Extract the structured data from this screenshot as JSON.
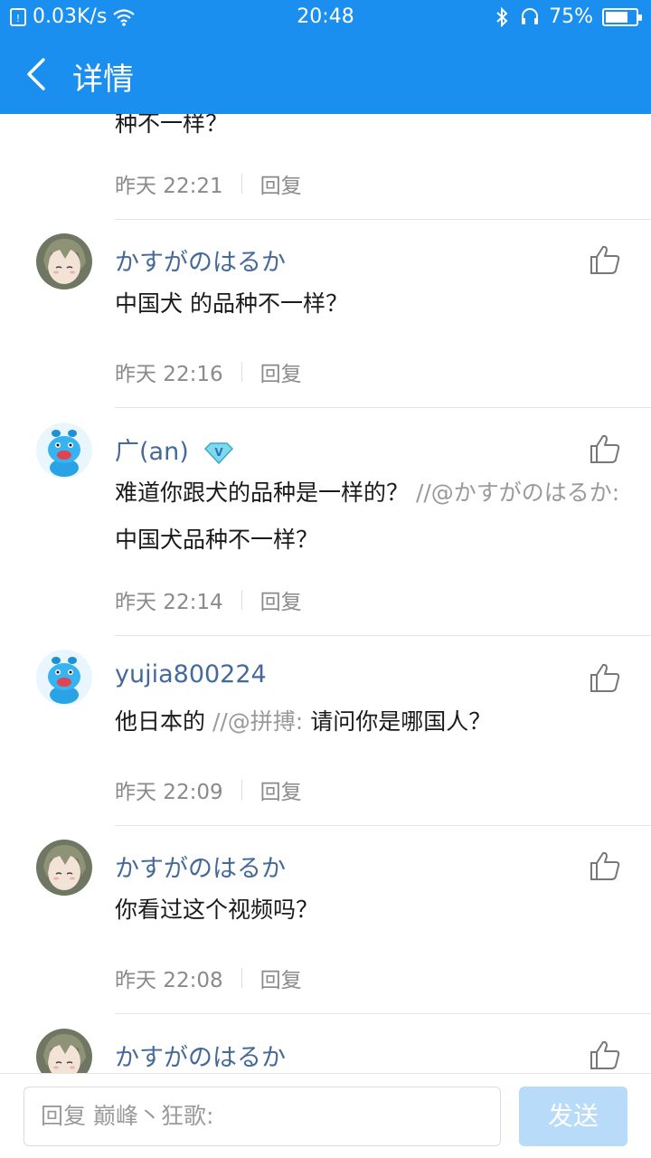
{
  "status_bar": {
    "speed": "0.03K/s",
    "time": "20:48",
    "battery": "75%",
    "battery_level": 0.75
  },
  "header": {
    "title": "详情"
  },
  "comments": [
    {
      "text": "种不一样？",
      "time": "昨天 22:21",
      "reply_label": "回复"
    },
    {
      "user": "かすがのはるか",
      "avatar": "anime-avatar",
      "text": "中国犬 的品种不一样？",
      "time": "昨天 22:16",
      "reply_label": "回复"
    },
    {
      "user": "广(an)",
      "avatar": "blue-dog-avatar",
      "badge": "vip-v-badge",
      "text": "难道你跟犬的品种是一样的？",
      "quote": " //@かすがのはるか: ",
      "quote_text": "中国犬品种不一样？",
      "time": "昨天 22:14",
      "reply_label": "回复"
    },
    {
      "user": "yujia800224",
      "avatar": "blue-dog-avatar",
      "text": "他日本的",
      "quote": " //@拼搏: ",
      "quote_text": "请问你是哪国人？",
      "time": "昨天 22:09",
      "reply_label": "回复"
    },
    {
      "user": "かすがのはるか",
      "avatar": "anime-avatar",
      "text": "你看过这个视频吗？",
      "time": "昨天 22:08",
      "reply_label": "回复"
    },
    {
      "user": "かすがのはるか",
      "avatar": "anime-avatar"
    }
  ],
  "reply_bar": {
    "placeholder": "回复 巅峰丶狂歌:",
    "send_label": "发送"
  },
  "colors": {
    "primary": "#1a8ff0",
    "username": "#456a9a",
    "send_disabled": "#b9dbfa"
  }
}
